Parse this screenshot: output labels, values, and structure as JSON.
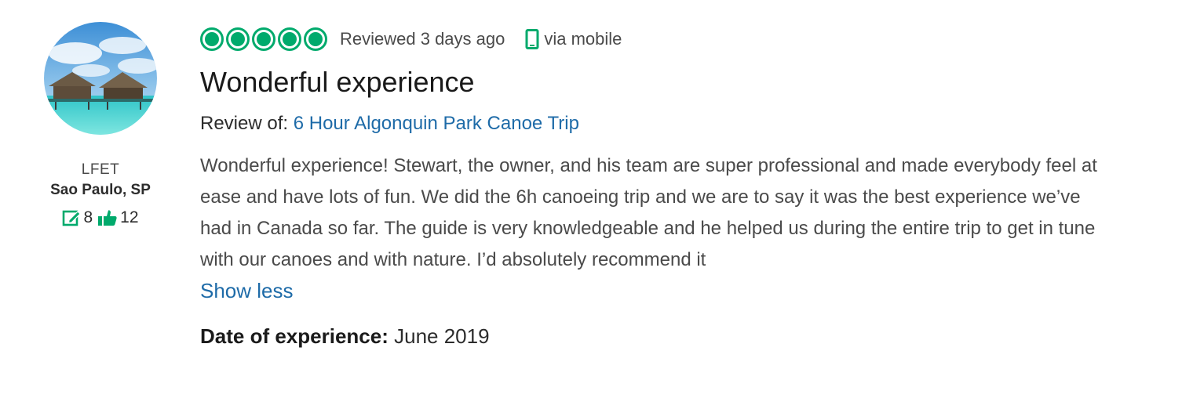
{
  "reviewer": {
    "avatar": "beach-bungalow-avatar",
    "username": "LFET",
    "location": "Sao Paulo, SP",
    "contributions": "8",
    "helpful_votes": "12",
    "contributions_icon": "edit-icon",
    "helpful_icon": "thumbs-up-icon"
  },
  "review": {
    "rating": 5,
    "rating_max": 5,
    "rating_color": "#00aa6c",
    "reviewed_text": "Reviewed 3 days ago",
    "mobile_icon": "mobile-phone-icon",
    "via_text": "via mobile",
    "title": "Wonderful experience",
    "review_of_label": "Review of:",
    "review_of_link": "6 Hour Algonquin Park Canoe Trip",
    "link_color": "#1e6ba8",
    "body": "Wonderful experience! Stewart, the owner, and his team are super professional and made everybody feel at ease and have lots of fun. We did the 6h canoeing trip and we are to say it was the best experience we’ve had in Canada so far. The guide is very knowledgeable and he helped us during the entire trip to get in tune with our canoes and with nature. I’d absolutely recommend it",
    "show_less": "Show less",
    "date_label": "Date of experience:",
    "date_value": "June 2019"
  }
}
